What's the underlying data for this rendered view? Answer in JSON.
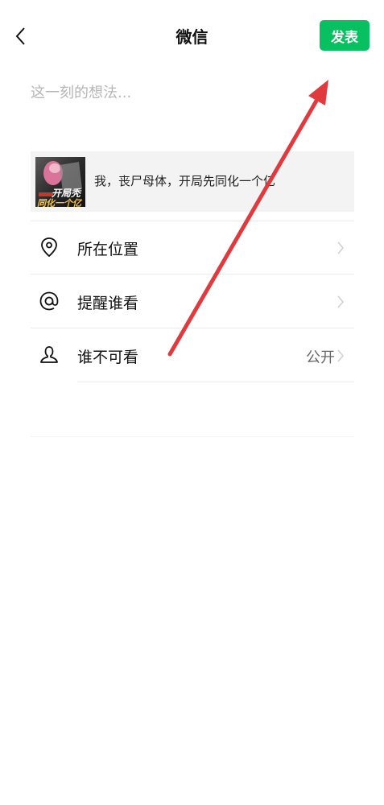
{
  "header": {
    "title": "微信",
    "publish_label": "发表",
    "back_icon": "chevron-left-icon"
  },
  "composer": {
    "placeholder": "这一刻的想法..."
  },
  "share_card": {
    "thumbnail_text_top": "开局秃",
    "thumbnail_text_bottom": "同化一个亿",
    "title": "我，丧尸母体，开局先同化一个亿"
  },
  "options": [
    {
      "icon": "location-pin-icon",
      "label": "所在位置",
      "value": ""
    },
    {
      "icon": "at-sign-icon",
      "label": "提醒谁看",
      "value": ""
    },
    {
      "icon": "person-icon",
      "label": "谁不可看",
      "value": "公开"
    }
  ],
  "colors": {
    "accent": "#07c160",
    "annotation_arrow": "#e03a3e",
    "card_bg": "#f3f3f3"
  }
}
